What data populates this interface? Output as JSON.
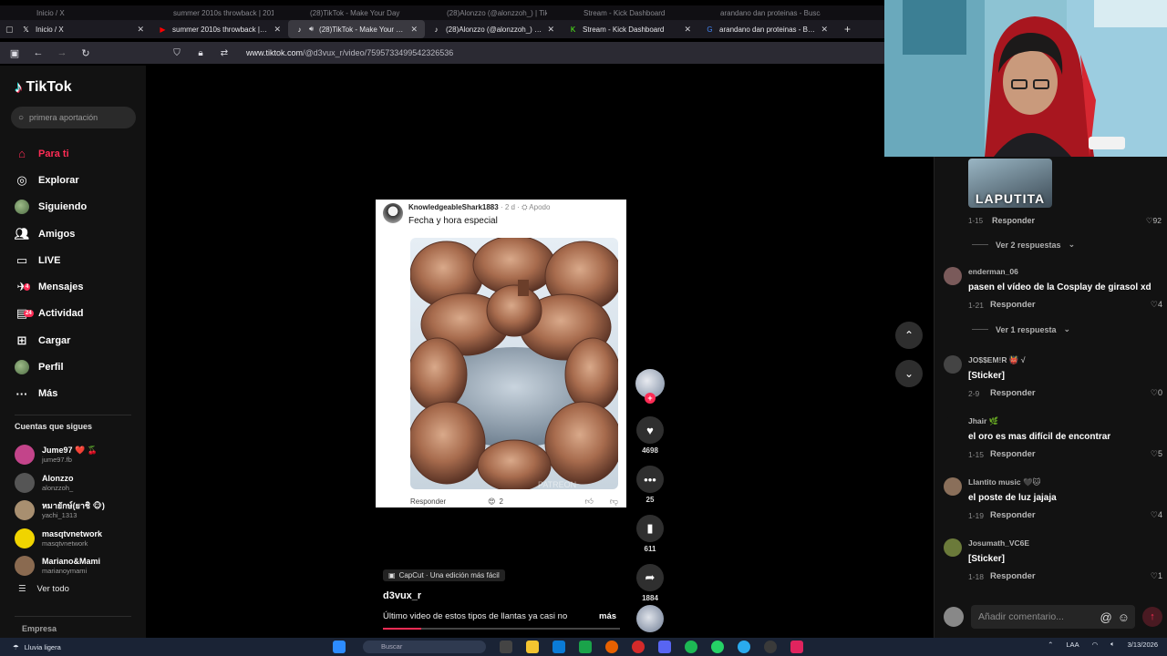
{
  "browser": {
    "ghost_tabs": [
      "Inicio / X",
      "summer 2010s throwback | 201",
      "(28)TikTok - Make Your Day",
      "(28)Alonzzo (@alonzzoh_) | Tik",
      "Stream - Kick Dashboard",
      "arandano dan proteinas - Busca"
    ],
    "tabs": [
      {
        "title": "Inicio / X",
        "icon": "x-logo-icon",
        "color": "#ffffff"
      },
      {
        "title": "summer 2010s throwback | 201",
        "icon": "youtube-icon",
        "color": "#ff0000"
      },
      {
        "title": "(28)TikTok - Make Your Day",
        "icon": "tiktok-icon",
        "color": "#ffffff",
        "active": true
      },
      {
        "title": "(28)Alonzzo (@alonzzoh_) | Tik",
        "icon": "tiktok-icon",
        "color": "#ffffff"
      },
      {
        "title": "Stream - Kick Dashboard",
        "icon": "kick-icon",
        "color": "#53fc18"
      },
      {
        "title": "arandano dan proteinas - Busca",
        "icon": "google-icon",
        "color": "#4285f4"
      }
    ],
    "url_domain": "www.tiktok.com",
    "url_path": "/@d3vux_r/video/7595733499542326536"
  },
  "sidebar": {
    "logo": "TikTok",
    "search_placeholder": "primera aportación",
    "nav": [
      {
        "label": "Para ti",
        "icon": "home-icon",
        "active": true
      },
      {
        "label": "Explorar",
        "icon": "compass-icon"
      },
      {
        "label": "Siguiendo",
        "icon": "following-avatar-icon"
      },
      {
        "label": "Amigos",
        "icon": "friends-icon"
      },
      {
        "label": "LIVE",
        "icon": "live-icon"
      },
      {
        "label": "Mensajes",
        "icon": "messages-icon",
        "badge": "4"
      },
      {
        "label": "Actividad",
        "icon": "activity-icon",
        "badge": "24"
      },
      {
        "label": "Cargar",
        "icon": "upload-icon"
      },
      {
        "label": "Perfil",
        "icon": "profile-avatar-icon"
      },
      {
        "label": "Más",
        "icon": "more-icon"
      }
    ],
    "following_title": "Cuentas que sigues",
    "following": [
      {
        "name": "Jume97 ❤️ 🍒",
        "handle": "jume97.fb",
        "color": "#c3448a"
      },
      {
        "name": "Alonzzo",
        "handle": "alonzzoh_",
        "color": "#555555"
      },
      {
        "name": "หมายักษ์(ยาชิ 🐵)",
        "handle": "yachi_1313",
        "color": "#a88f70"
      },
      {
        "name": "masqtvnetwork",
        "handle": "masqtvnetwork",
        "color": "#f0d400"
      },
      {
        "name": "Mariano&Mami",
        "handle": "marianoymami",
        "color": "#8a6a50"
      }
    ],
    "see_all": "Ver todo",
    "company": "Empresa"
  },
  "video": {
    "comment_user": "KnowledgeableShark1883",
    "comment_age": "2 d",
    "comment_tag": "Apodo",
    "comment_text": "Fecha y hora especial",
    "reply_label": "Responder",
    "reaction_count": "2",
    "watermark": "PATREON",
    "capcut": "CapCut · Una edición más fácil",
    "author": "d3vux_r",
    "description": "Último video de estos tipos de llantas ya casi no",
    "more": "más",
    "progress": 0.16
  },
  "actions": {
    "likes": "4698",
    "comments": "25",
    "saves": "611",
    "shares": "1884"
  },
  "comments": {
    "sticker_label": "LAPUTITA",
    "reply_label": "Responder",
    "top": {
      "date": "1-15",
      "likes": "92",
      "replies": "Ver 2 respuestas"
    },
    "items": [
      {
        "user": "enderman_06",
        "text": "pasen el vídeo de la Cosplay de girasol xd",
        "date": "1-21",
        "likes": "4",
        "replies": "Ver 1 respuesta",
        "color": "#7a5a5a"
      },
      {
        "user": "JO$$EM!R 👹 √",
        "text": "[Sticker]",
        "date": "2-9",
        "likes": "0",
        "color": "#444444"
      },
      {
        "user": "Jhair 🌿",
        "text": "el oro es mas difícil de encontrar",
        "date": "1-15",
        "likes": "5",
        "color": "#121212"
      },
      {
        "user": "Llantito music 🖤🐱",
        "text": "el poste de luz jajaja",
        "date": "1-19",
        "likes": "4",
        "color": "#8a6f5a"
      },
      {
        "user": "Josumath_VC6E",
        "text": "[Sticker]",
        "date": "1-18",
        "likes": "1",
        "color": "#6b7a3a"
      }
    ],
    "add_placeholder": "Añadir comentario..."
  },
  "taskbar": {
    "weather": "Lluvia ligera",
    "search": "Buscar",
    "lang": "LAA",
    "date": "3/13/2026"
  }
}
